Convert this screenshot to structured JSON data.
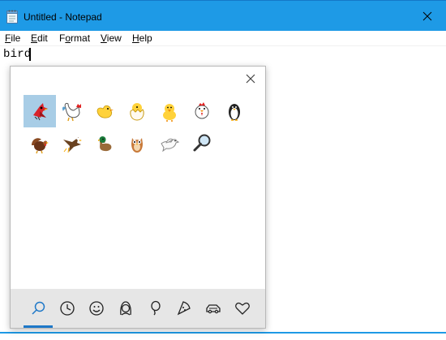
{
  "window": {
    "title": "Untitled - Notepad",
    "title_icon": "notepad-icon",
    "close_icon": "close-icon"
  },
  "menu": {
    "items": [
      {
        "label": "File",
        "mnemonic": "F"
      },
      {
        "label": "Edit",
        "mnemonic": "E"
      },
      {
        "label": "Format",
        "mnemonic": "o"
      },
      {
        "label": "View",
        "mnemonic": "V"
      },
      {
        "label": "Help",
        "mnemonic": "H"
      }
    ]
  },
  "editor": {
    "text": "bird"
  },
  "emoji_panel": {
    "close_icon": "close-icon",
    "results": [
      "cardinal-bird",
      "rooster",
      "baby-chick",
      "hatching-chick",
      "front-facing-baby-chick",
      "chicken",
      "penguin",
      "turkey",
      "eagle",
      "duck",
      "owl",
      "dove",
      "magnifying-glass"
    ],
    "selected_index": 0,
    "categories": [
      "search-icon",
      "recent-icon",
      "smiley-icon",
      "people-icon",
      "balloon-icon",
      "pizza-icon",
      "car-icon",
      "heart-icon"
    ],
    "active_category": 0
  },
  "colors": {
    "titlebar": "#1e9ae6",
    "selection": "#a8cde6",
    "category_bar": "#e6e6e6",
    "accent": "#1e78c8"
  }
}
